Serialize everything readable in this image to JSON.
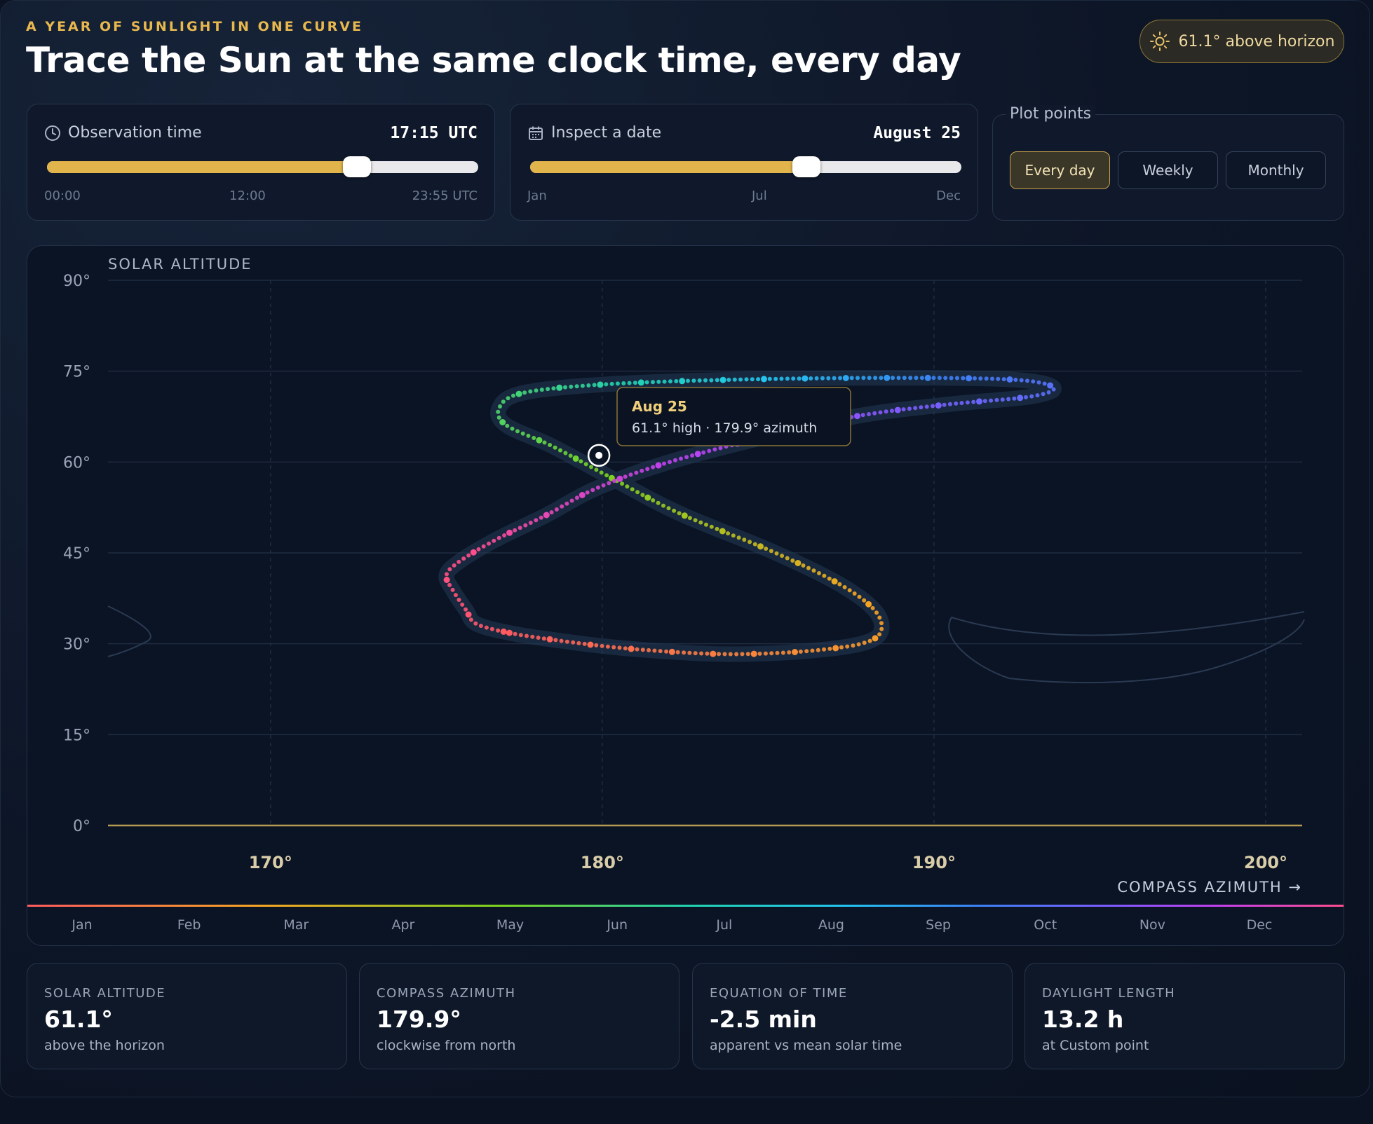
{
  "header": {
    "eyebrow": "A YEAR OF SUNLIGHT IN ONE CURVE",
    "title": "Trace the Sun at the same clock time, every day",
    "badge": "61.1° above horizon"
  },
  "controls": {
    "time": {
      "label": "Observation time",
      "value": "17:15 UTC",
      "level": 0.718,
      "ticks": [
        "00:00",
        "12:00",
        "23:55 UTC"
      ]
    },
    "date": {
      "label": "Inspect a date",
      "value": "August 25",
      "level": 0.64,
      "ticks": [
        "Jan",
        "Jul",
        "Dec"
      ]
    },
    "plot_points": {
      "legend": "Plot points",
      "options": [
        "Every day",
        "Weekly",
        "Monthly"
      ],
      "selected": "Every day"
    }
  },
  "chart_data": {
    "type": "scatter",
    "title": "SOLAR ALTITUDE",
    "xlabel": "COMPASS AZIMUTH →",
    "ylabel": "",
    "xlim": [
      165.1,
      201.1
    ],
    "ylim": [
      0,
      90
    ],
    "x_ticks": [
      "170°",
      "180°",
      "190°",
      "200°"
    ],
    "y_ticks": [
      "0°",
      "15°",
      "30°",
      "45°",
      "60°",
      "75°",
      "90°"
    ],
    "month_labels": [
      "Jan",
      "Feb",
      "Mar",
      "Apr",
      "May",
      "Jun",
      "Jul",
      "Aug",
      "Sep",
      "Oct",
      "Nov",
      "Dec"
    ],
    "grid": true,
    "series": [
      {
        "points": [
          [
            177.2,
            31.8
          ],
          [
            178.6,
            30.6
          ],
          [
            180.4,
            29.4
          ],
          [
            182.6,
            28.5
          ],
          [
            184.3,
            28.3
          ],
          [
            186.2,
            28.8
          ],
          [
            187.8,
            30.0
          ],
          [
            188.4,
            32.0
          ],
          [
            188.2,
            35.6
          ],
          [
            187.1,
            40.0
          ],
          [
            185.1,
            45.3
          ],
          [
            182.3,
            51.6
          ],
          [
            180.2,
            57.6
          ],
          [
            178.5,
            62.6
          ],
          [
            177.1,
            66.1
          ],
          [
            176.9,
            69.0
          ],
          [
            177.6,
            71.4
          ],
          [
            180.0,
            72.8
          ],
          [
            184.0,
            73.6
          ],
          [
            188.8,
            73.9
          ],
          [
            192.4,
            73.6
          ],
          [
            193.6,
            72.3
          ],
          [
            192.9,
            70.8
          ],
          [
            190.4,
            69.5
          ],
          [
            187.7,
            67.6
          ],
          [
            184.8,
            64.0
          ],
          [
            181.9,
            59.8
          ],
          [
            179.8,
            55.6
          ],
          [
            178.3,
            51.2
          ],
          [
            176.8,
            47.2
          ],
          [
            175.7,
            43.6
          ],
          [
            175.3,
            41.3
          ],
          [
            175.5,
            38.8
          ],
          [
            175.9,
            35.5
          ],
          [
            176.2,
            33.3
          ],
          [
            177.2,
            31.8
          ]
        ]
      }
    ],
    "selected_point": {
      "date": "Aug 25",
      "azimuth": 179.9,
      "altitude": 61.1
    },
    "tooltip": {
      "title": "Aug 25",
      "text": "61.1° high · 179.9° azimuth"
    },
    "colors": {
      "winter": "#ff5a5f",
      "spring": "#f5a623",
      "summer_green": "#7ad320",
      "teal": "#22d3b0",
      "cyan": "#22c6f0",
      "blue": "#3b82f6",
      "violet": "#7c5cff",
      "magenta": "#c040f0",
      "pink": "#ff4d8d",
      "horizon": "#b99a55"
    }
  },
  "stats": [
    {
      "key": "SOLAR ALTITUDE",
      "value": "61.1°",
      "sub": "above the horizon"
    },
    {
      "key": "COMPASS AZIMUTH",
      "value": "179.9°",
      "sub": "clockwise from north"
    },
    {
      "key": "EQUATION OF TIME",
      "value": "-2.5 min",
      "sub": "apparent vs mean solar time"
    },
    {
      "key": "DAYLIGHT LENGTH",
      "value": "13.2 h",
      "sub": "at Custom point"
    }
  ]
}
